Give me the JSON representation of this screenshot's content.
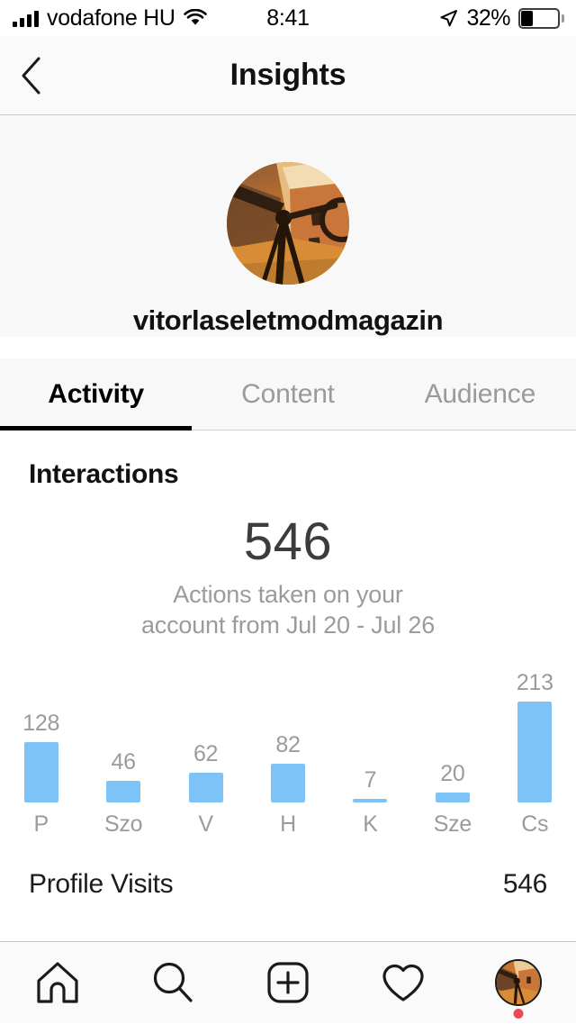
{
  "status_bar": {
    "carrier": "vodafone HU",
    "time": "8:41",
    "battery_percent": "32%",
    "battery_level": 32,
    "signal_icon": "signal-bars-icon",
    "wifi_icon": "wifi-icon",
    "location_icon": "location-arrow-icon",
    "battery_icon": "battery-icon"
  },
  "nav": {
    "title": "Insights",
    "back_icon": "chevron-left-icon"
  },
  "profile": {
    "username": "vitorlaseletmodmagazin",
    "avatar_icon": "profile-avatar"
  },
  "tabs": [
    {
      "label": "Activity",
      "active": true
    },
    {
      "label": "Content",
      "active": false
    },
    {
      "label": "Audience",
      "active": false
    }
  ],
  "interactions": {
    "title": "Interactions",
    "total": "546",
    "subtitle_line1": "Actions taken on your",
    "subtitle_line2": "account from Jul 20 - Jul 26"
  },
  "metrics": [
    {
      "label": "Profile Visits",
      "value": "546"
    }
  ],
  "bottom_nav": [
    {
      "name": "home-icon",
      "label": "Home"
    },
    {
      "name": "search-icon",
      "label": "Search"
    },
    {
      "name": "add-post-icon",
      "label": "New Post"
    },
    {
      "name": "heart-icon",
      "label": "Activity"
    },
    {
      "name": "profile-avatar-icon",
      "label": "Profile"
    }
  ],
  "colors": {
    "bar": "#7ec3f7",
    "accent_black": "#000000",
    "muted_text": "#9b9b9b",
    "notification_dot": "#ed4956"
  },
  "chart_data": {
    "type": "bar",
    "title": "Interactions",
    "subtitle": "Actions taken on your account from Jul 20 - Jul 26",
    "categories": [
      "P",
      "Szo",
      "V",
      "H",
      "K",
      "Sze",
      "Cs"
    ],
    "values": [
      128,
      46,
      62,
      82,
      7,
      20,
      213
    ],
    "labels": [
      "128",
      "46",
      "62",
      "82",
      "7",
      "20",
      "213"
    ],
    "xlabel": "",
    "ylabel": "",
    "ylim": [
      0,
      213
    ],
    "grid": false,
    "legend": false,
    "bar_color": "#7ec3f7",
    "value_label_color": "#9b9b9b"
  }
}
